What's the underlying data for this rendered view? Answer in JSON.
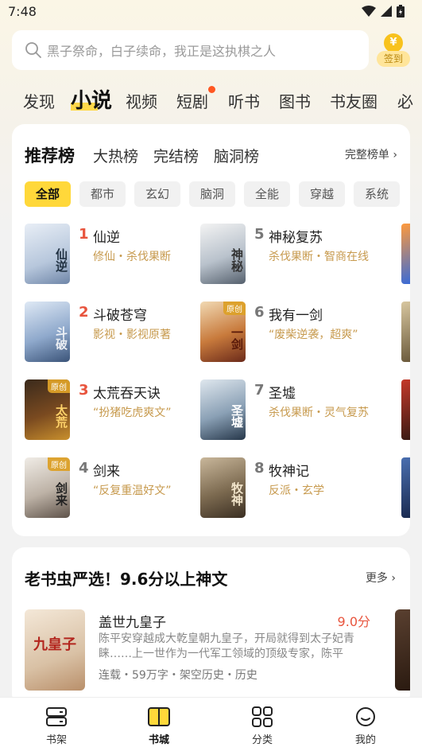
{
  "status": {
    "time": "7:48"
  },
  "search": {
    "placeholder": "黑子祭命，白子续命，我正是这执棋之人",
    "signin_label": "签到",
    "coin_symbol": "¥"
  },
  "top_tabs": [
    "发现",
    "小说",
    "视频",
    "短剧",
    "听书",
    "图书",
    "书友圈",
    "必"
  ],
  "ranking": {
    "tabs": [
      "推荐榜",
      "大热榜",
      "完结榜",
      "脑洞榜"
    ],
    "more": "完整榜单 ›",
    "chips": [
      "全部",
      "都市",
      "玄幻",
      "脑洞",
      "全能",
      "穿越",
      "系统"
    ],
    "books": [
      {
        "rank": "1",
        "title": "仙逆",
        "sub": "修仙・杀伐果断",
        "cover_text": "仙逆",
        "tag": ""
      },
      {
        "rank": "2",
        "title": "斗破苍穹",
        "sub": "影视・影视原著",
        "cover_text": "斗破",
        "tag": ""
      },
      {
        "rank": "3",
        "title": "太荒吞天诀",
        "sub": "“扮猪吃虎爽文”",
        "cover_text": "太荒",
        "tag": "原创"
      },
      {
        "rank": "4",
        "title": "剑来",
        "sub": "“反复重温好文”",
        "cover_text": "剑来",
        "tag": "原创"
      },
      {
        "rank": "5",
        "title": "神秘复苏",
        "sub": "杀伐果断・智商在线",
        "cover_text": "神秘",
        "tag": ""
      },
      {
        "rank": "6",
        "title": "我有一剑",
        "sub": "“废柴逆袭，超爽”",
        "cover_text": "一剑",
        "tag": "原创"
      },
      {
        "rank": "7",
        "title": "圣墟",
        "sub": "杀伐果断・灵气复苏",
        "cover_text": "圣墟",
        "tag": ""
      },
      {
        "rank": "8",
        "title": "牧神记",
        "sub": "反派・玄学",
        "cover_text": "牧神",
        "tag": ""
      }
    ]
  },
  "featured": {
    "title": "老书虫严选！9.6分以上神文",
    "more": "更多 ›",
    "book": {
      "title": "盖世九皇子",
      "score": "9.0分",
      "desc": "陈平安穿越成大乾皇朝九皇子，开局就得到太子妃青睐……上一世作为一代军工领域的顶级专家，陈平",
      "meta": "连载・59万字・架空历史・历史",
      "cover_text": "九皇子"
    }
  },
  "bottom_nav": [
    "书架",
    "书城",
    "分类",
    "我的"
  ],
  "colors": {
    "accent": "#ffd83a",
    "rank_red": "#e8543d",
    "sub_gold": "#c79a4e"
  }
}
